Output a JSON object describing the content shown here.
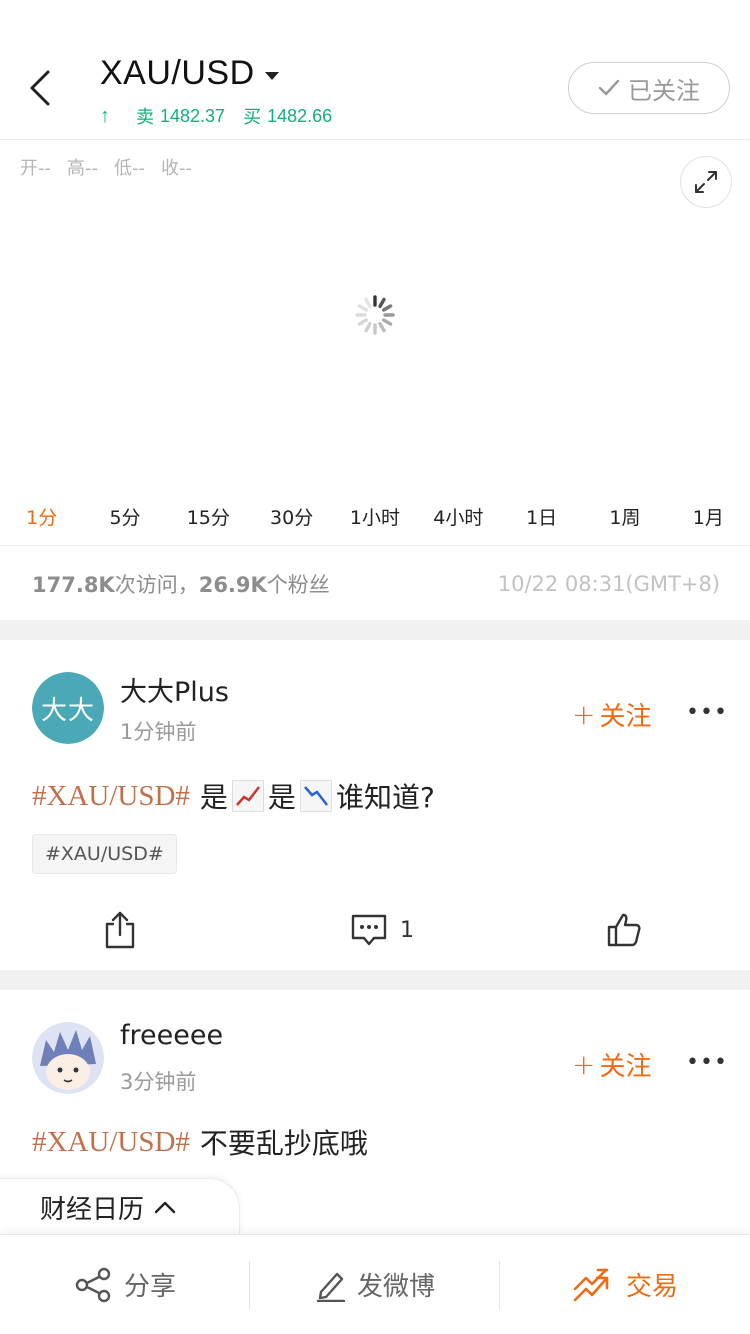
{
  "header": {
    "symbol": "XAU/USD",
    "trend_arrow": "↑",
    "sell_label": "卖",
    "sell_price": "1482.37",
    "buy_label": "买",
    "buy_price": "1482.66",
    "follow_state_label": "已关注",
    "quote_color": "#10b07a"
  },
  "chart": {
    "ohlc": [
      {
        "label": "开",
        "value": "--"
      },
      {
        "label": "高",
        "value": "--"
      },
      {
        "label": "低",
        "value": "--"
      },
      {
        "label": "收",
        "value": "--"
      }
    ],
    "loading_icon": "spinner-icon",
    "expand_icon": "expand-icon"
  },
  "timeframes": [
    "1分",
    "5分",
    "15分",
    "30分",
    "1小时",
    "4小时",
    "1日",
    "1周",
    "1月"
  ],
  "active_timeframe": "1分",
  "stats": {
    "visits_value": "177.8K",
    "visits_label": "次访问，",
    "fans_value": "26.9K",
    "fans_label": "个粉丝",
    "datetime": "10/22 08:31(GMT+8)"
  },
  "posts": [
    {
      "avatar_text": "大大",
      "author": "大大Plus",
      "time": "1分钟前",
      "follow_label": "关注",
      "follow_plus": "+",
      "more": "•••",
      "hashtag": "#XAU/USD#",
      "text_1": "是",
      "emoji_1": "chart-up-emoji",
      "text_2": "是",
      "emoji_2": "chart-down-emoji",
      "text_3": "谁知道?",
      "tag_chip": "#XAU/USD#",
      "comment_count": "1"
    },
    {
      "author": "freeeee",
      "time": "3分钟前",
      "follow_label": "关注",
      "follow_plus": "+",
      "more": "•••",
      "hashtag": "#XAU/USD#",
      "text_1": "不要乱抄底哦"
    }
  ],
  "calendar_tab": {
    "label": "财经日历"
  },
  "bottom_bar": {
    "share_label": "分享",
    "post_label": "发微博",
    "trade_label": "交易"
  },
  "colors": {
    "accent": "#f06a12",
    "hashtag": "#c0714b",
    "up_green": "#10b07a"
  }
}
